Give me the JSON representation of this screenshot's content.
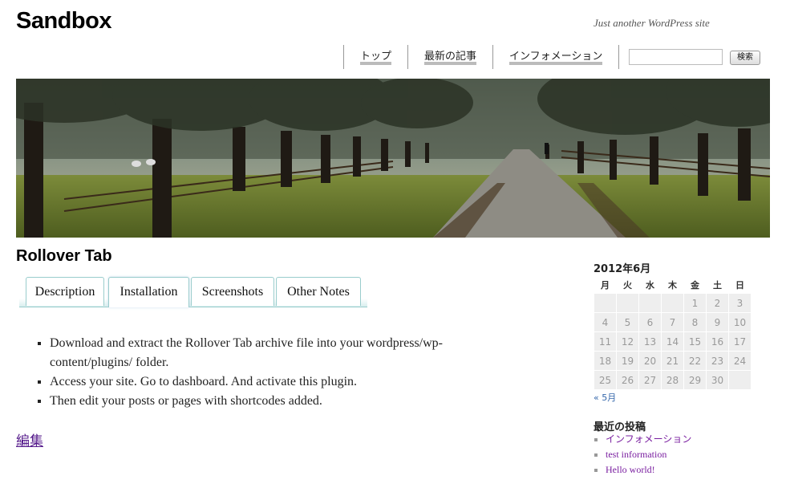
{
  "site": {
    "title": "Sandbox",
    "tagline": "Just another WordPress site"
  },
  "nav": {
    "items": [
      {
        "label": "トップ"
      },
      {
        "label": "最新の記事"
      },
      {
        "label": "インフォメーション"
      }
    ]
  },
  "search": {
    "value": "",
    "button_label": "検索"
  },
  "entry": {
    "title": "Rollover Tab",
    "tabs": [
      {
        "label": "Description"
      },
      {
        "label": "Installation"
      },
      {
        "label": "Screenshots"
      },
      {
        "label": "Other Notes"
      }
    ],
    "active_tab": "Installation",
    "steps": [
      "Download and extract the Rollover Tab archive file into your wordpress/wp-content/plugins/ folder.",
      "Access your site. Go to dashboard. And activate this plugin.",
      "Then edit your posts or pages with shortcodes added."
    ],
    "edit_link": "編集"
  },
  "calendar": {
    "caption": "2012年6月",
    "weekdays": [
      "月",
      "火",
      "水",
      "木",
      "金",
      "土",
      "日"
    ],
    "weeks": [
      [
        "",
        "",
        "",
        "",
        "1",
        "2",
        "3"
      ],
      [
        "4",
        "5",
        "6",
        "7",
        "8",
        "9",
        "10"
      ],
      [
        "11",
        "12",
        "13",
        "14",
        "15",
        "16",
        "17"
      ],
      [
        "18",
        "19",
        "20",
        "21",
        "22",
        "23",
        "24"
      ],
      [
        "25",
        "26",
        "27",
        "28",
        "29",
        "30",
        ""
      ]
    ],
    "prev_link": "« 5月"
  },
  "recent_posts": {
    "title": "最近の投稿",
    "items": [
      "インフォメーション",
      "test information",
      "Hello world!"
    ]
  }
}
